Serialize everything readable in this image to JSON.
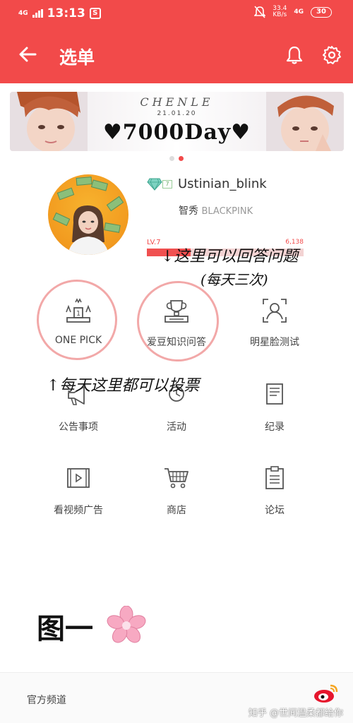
{
  "status_bar": {
    "network": "4G",
    "time": "13:13",
    "speed_value": "33.4",
    "speed_unit": "KB/s",
    "network_right": "4G",
    "battery": "30"
  },
  "header": {
    "title": "选单",
    "accent_color": "#f24a4a"
  },
  "banner": {
    "brand": "CHENLE",
    "date": "21.01.20",
    "headline": "♥7000Day♥",
    "slide_count": 2,
    "active_slide": 2
  },
  "profile": {
    "username": "Ustinian_blink",
    "gem_level": "7",
    "member_name": "智秀",
    "group_name": "BLACKPINK",
    "level_label": "LV.7",
    "xp_value": "6,138",
    "level_progress": 0.28
  },
  "menu": {
    "one_pick": "ONE PICK",
    "idol_quiz": "爱豆知识问答",
    "face_test": "明星脸测试",
    "notice": "公告事项",
    "event": "活动",
    "schedule": "纪录",
    "watch_ads": "看视频广告",
    "shop": "商店",
    "forum": "论坛"
  },
  "annotations": {
    "quiz_note_line1": "↓这里可以回答问题",
    "quiz_note_line2": "(每天三次)",
    "vote_note": "↑每天这里都可以投票",
    "figure_caption": "图一"
  },
  "footer": {
    "channel": "官方频道",
    "watermark": "知乎 @世间温柔都给你"
  }
}
